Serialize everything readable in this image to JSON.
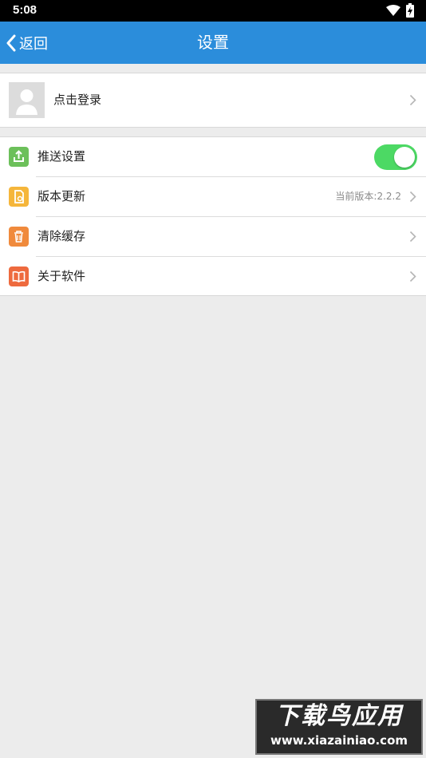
{
  "status_bar": {
    "time": "5:08",
    "icons": [
      "wifi-icon",
      "battery-charging-icon"
    ]
  },
  "app_bar": {
    "back_label": "返回",
    "title": "设置",
    "color": "#2b8ddb"
  },
  "login": {
    "label": "点击登录",
    "avatar_icon": "default-avatar-icon"
  },
  "settings": [
    {
      "label": "推送设置",
      "icon": "push-icon",
      "icon_color": "#6cc05a",
      "control": "toggle",
      "enabled": true
    },
    {
      "label": "版本更新",
      "icon": "update-icon",
      "icon_color": "#f5b63b",
      "value": "当前版本:2.2.2"
    },
    {
      "label": "清除缓存",
      "icon": "trash-icon",
      "icon_color": "#f08a3c"
    },
    {
      "label": "关于软件",
      "icon": "book-icon",
      "icon_color": "#ee6a3e"
    }
  ],
  "watermark": {
    "title": "下载鸟应用",
    "url": "www.xiazainiao.com"
  }
}
